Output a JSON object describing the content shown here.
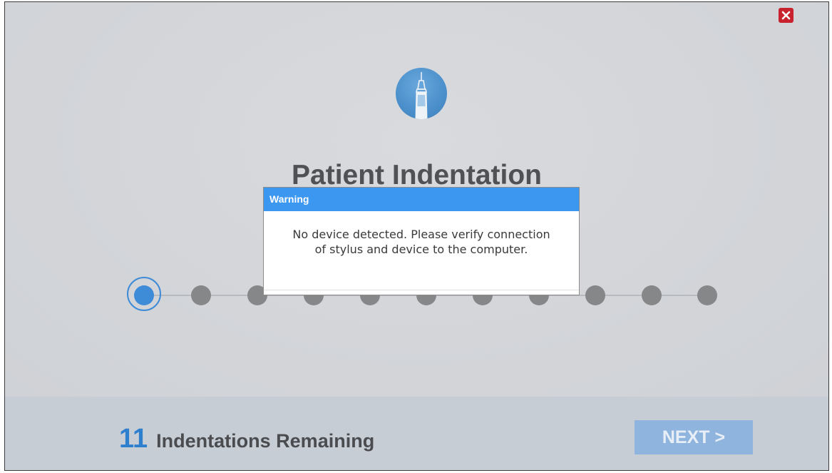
{
  "window": {
    "close_icon": "close-x-icon",
    "close_color": "#c8222e"
  },
  "header": {
    "logo_icon": "stylus-pen-icon",
    "title": "Patient Indentation"
  },
  "stepper": {
    "total_steps": 11,
    "current_step": 1,
    "active_color": "#3e8bd8",
    "inactive_color": "#858789"
  },
  "footer": {
    "remaining_count": "11",
    "remaining_label": "Indentations Remaining",
    "next_label": "NEXT >"
  },
  "dialog": {
    "title": "Warning",
    "message": "No device detected. Please verify connection of stylus and device to the computer.",
    "header_color": "#3c97f0"
  }
}
